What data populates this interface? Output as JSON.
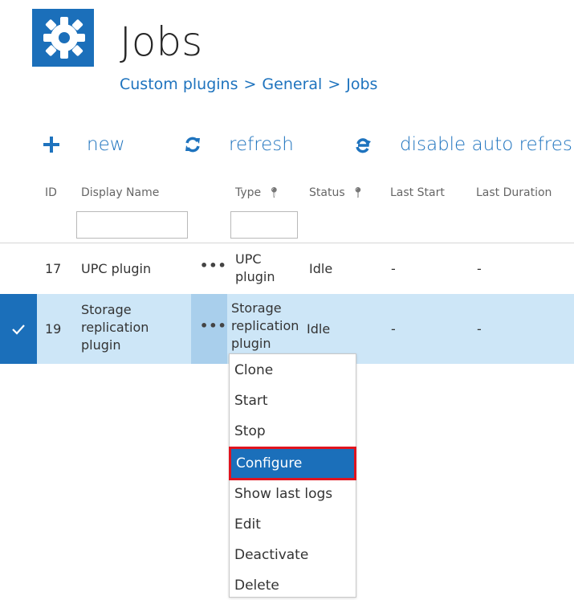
{
  "header": {
    "title": "Jobs",
    "breadcrumb": [
      "Custom plugins",
      "General",
      "Jobs"
    ],
    "breadcrumb_separator": ">"
  },
  "toolbar": {
    "new_label": "new",
    "refresh_label": "refresh",
    "disable_auto_refresh_label": "disable auto refres"
  },
  "columns": {
    "id": "ID",
    "display_name": "Display Name",
    "type": "Type",
    "status": "Status",
    "last_start": "Last Start",
    "last_duration": "Last Duration"
  },
  "filters": {
    "display_name_value": "",
    "type_value": ""
  },
  "rows": [
    {
      "id": "17",
      "name_lines": [
        "UPC plugin"
      ],
      "type_lines": [
        "UPC",
        "plugin"
      ],
      "status": "Idle",
      "last_start": "-",
      "last_duration": "-",
      "selected": false
    },
    {
      "id": "19",
      "name_lines": [
        "Storage",
        "replication",
        "plugin"
      ],
      "type_lines": [
        "Storage",
        "replication",
        "plugin"
      ],
      "status": "Idle",
      "last_start": "-",
      "last_duration": "-",
      "selected": true
    }
  ],
  "context_menu": {
    "items": [
      "Clone",
      "Start",
      "Stop",
      "Configure",
      "Show last logs",
      "Edit",
      "Deactivate",
      "Delete"
    ],
    "highlighted": "Configure"
  },
  "colors": {
    "accent": "#1e73be",
    "selected_row": "#cde6f7",
    "selected_check": "#1b6fba",
    "highlight_border": "#e0141f"
  },
  "icons": {
    "logo": "gear-icon",
    "new": "plus-icon",
    "refresh": "refresh-icon",
    "disable_auto_refresh": "auto-refresh-icon",
    "selected": "checkmark-icon",
    "row_menu": "ellipsis-icon",
    "column_filter": "pin-icon"
  }
}
